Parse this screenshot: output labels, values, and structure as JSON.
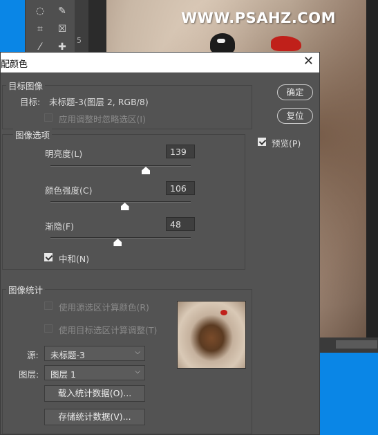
{
  "background": {
    "ruler_number": "5",
    "watermark": "WWW.PSAHZ.COM"
  },
  "dialog": {
    "title": "配颜色",
    "target_group": {
      "label": "目标图像",
      "target_prefix": "目标:",
      "target_value": "未标题-3(图层 2, RGB/8)",
      "ignore_selection": "应用调整时忽略选区(I)"
    },
    "image_options": {
      "label": "图像选项",
      "luminance": {
        "label": "明亮度(L)",
        "value": "139"
      },
      "color_intensity": {
        "label": "颜色强度(C)",
        "value": "106"
      },
      "fade": {
        "label": "渐隐(F)",
        "value": "48"
      },
      "neutralize": "中和(N)"
    },
    "image_stats": {
      "label": "图像统计",
      "use_source_selection": "使用源选区计算颜色(R)",
      "use_target_selection": "使用目标选区计算调整(T)",
      "source_label": "源:",
      "source_value": "未标题-3",
      "layer_label": "图层:",
      "layer_value": "图层 1",
      "load_button": "载入统计数据(O)...",
      "save_button": "存储统计数据(V)..."
    },
    "buttons": {
      "ok": "确定",
      "reset": "复位"
    },
    "preview": "预览(P)"
  },
  "slider_levels": {
    "luminance": 0.68,
    "color_intensity": 0.53,
    "fade": 0.48
  },
  "colors": {
    "dialog_bg": "#535353",
    "titlebar_bg": "#ffffff",
    "windows_blue": "#0a86e6"
  }
}
